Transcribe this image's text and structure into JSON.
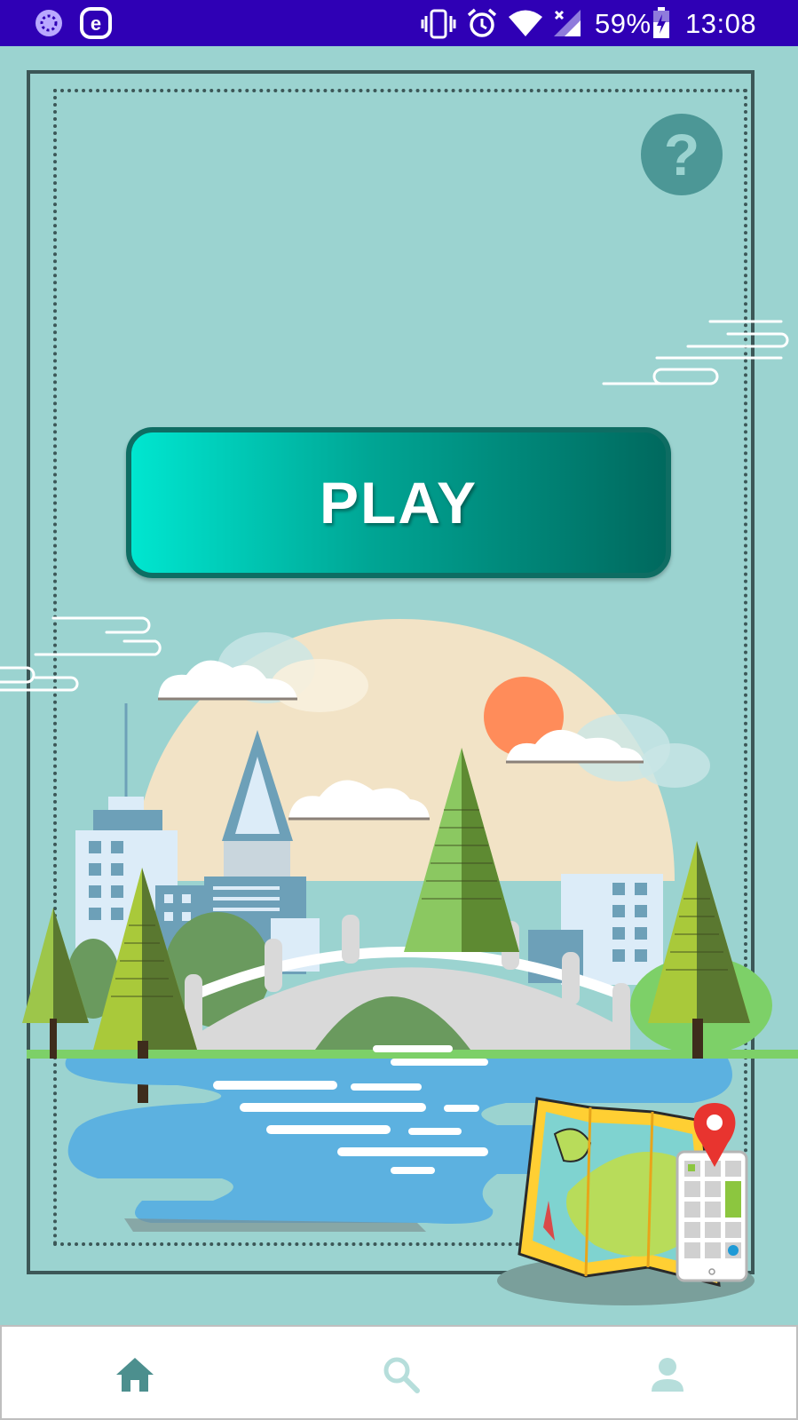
{
  "status_bar": {
    "battery_percent": "59%",
    "time": "13:08",
    "icons": [
      "spinner-app-icon",
      "e-app-icon",
      "vibrate-icon",
      "alarm-icon",
      "wifi-icon",
      "signal-icon",
      "battery-charging-icon"
    ]
  },
  "main": {
    "help_button": {
      "icon": "question-mark-icon",
      "label": "?"
    },
    "play_button": {
      "label": "PLAY"
    }
  },
  "bottom_nav": {
    "items": [
      {
        "name": "home",
        "icon": "home-icon",
        "active": true
      },
      {
        "name": "search",
        "icon": "search-icon",
        "active": false
      },
      {
        "name": "profile",
        "icon": "profile-icon",
        "active": false
      }
    ]
  },
  "colors": {
    "background": "#9bd3d0",
    "status_bar": "#2f00b5",
    "play_gradient_start": "#00e6d0",
    "play_gradient_end": "#00695e",
    "nav_active": "#4c8f8e",
    "nav_inactive": "#b6dedb"
  }
}
